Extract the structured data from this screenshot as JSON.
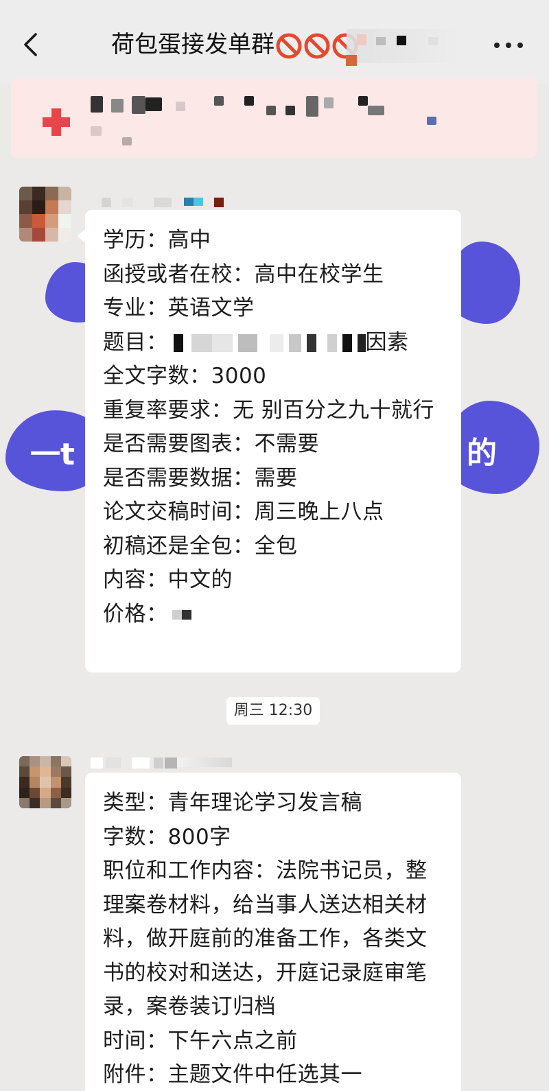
{
  "header": {
    "title": "荷包蛋接发单群",
    "back_icon": "chevron-left-icon",
    "more_icon": "more-horizontal-icon",
    "title_icons": [
      "ban-icon",
      "ban-icon",
      "ban-icon"
    ],
    "colors": {
      "background": "#ededed",
      "ban_red": "#e8472e"
    }
  },
  "pinned_notice": {
    "icon": "red-plus-icon",
    "background": "#fde8e8"
  },
  "messages": [
    {
      "sender_avatar": "avatar-blurred",
      "lines": [
        "学历：高中",
        "函授或者在校：高中在校学生",
        "专业：英语文学",
        "题目：",
        "因素",
        "全文字数：3000",
        "重复率要求：无 别百分之九十就行",
        "是否需要图表：不需要",
        "是否需要数据：需要",
        "论文交稿时间：周三晚上八点",
        "初稿还是全包：全包",
        "内容：中文的",
        "价格："
      ]
    },
    {
      "sender_avatar": "avatar-blurred",
      "lines": [
        "类型：青年理论学习发言稿",
        "字数：800字",
        "职位和工作内容：法院书记员，整理案卷材料，给当事人送达相关材料，做开庭前的准备工作，各类文书的校对和送达，开庭记录庭审笔录，案卷装订归档",
        "时间：下午六点之前",
        "附件：主题文件中任选其一"
      ]
    }
  ],
  "timestamp": "周三 12:30",
  "background_doodles": [
    "一t",
    "的"
  ],
  "colors": {
    "chat_background": "#ece9e9",
    "bubble": "#ffffff",
    "doodle": "#4b47d8"
  }
}
